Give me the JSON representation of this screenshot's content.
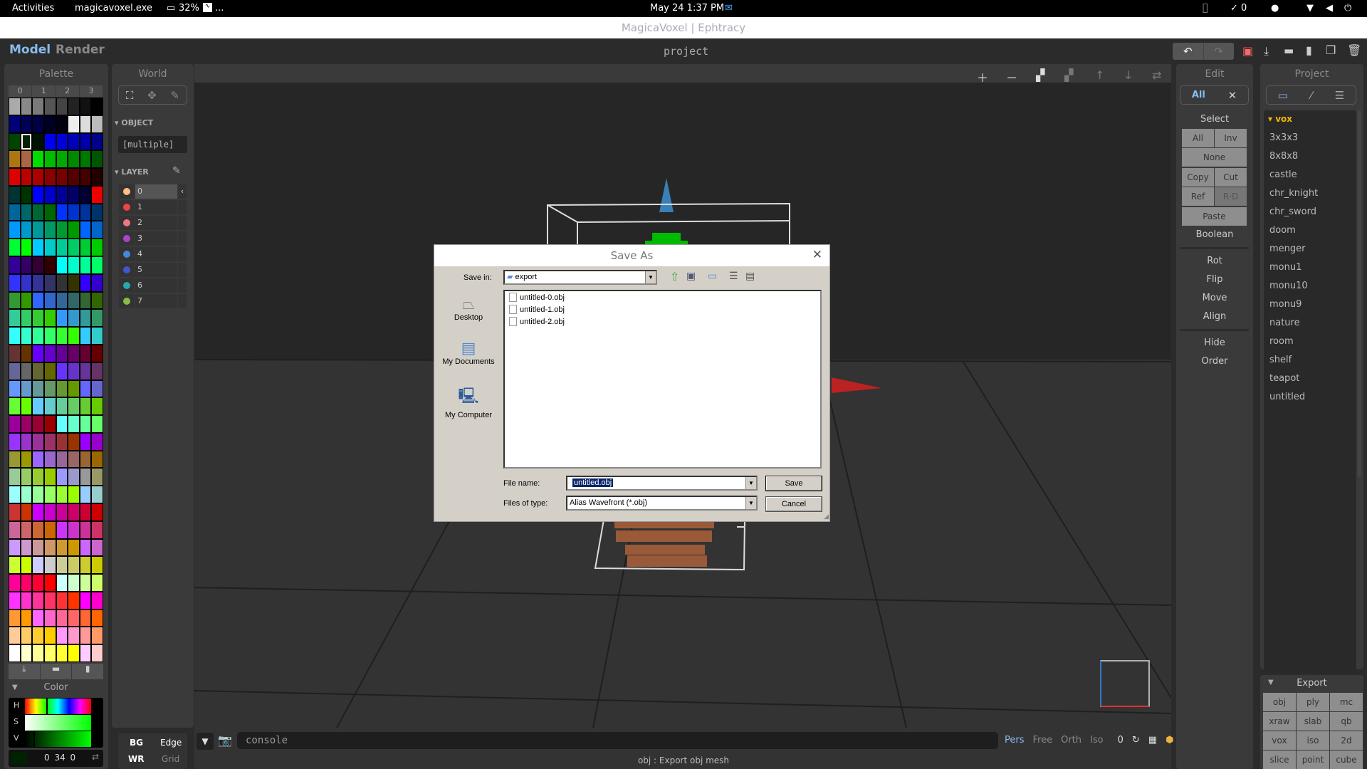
{
  "topbar": {
    "activities": "Activities",
    "app": "magicavoxel.exe",
    "cpu": "32%",
    "more": "...",
    "datetime": "May 24  1:37 PM",
    "check_count": "✓ 0"
  },
  "window_title": "MagicaVoxel | Ephtracy",
  "modes": {
    "model": "Model",
    "render": "Render"
  },
  "project_title": "project",
  "palette": {
    "title": "Palette",
    "tabs": [
      "0",
      "1",
      "2",
      "3"
    ],
    "selected_index": 17,
    "rows": [
      [
        "#aaaaaa",
        "#888888",
        "#7a7a7a",
        "#555555",
        "#444444",
        "#222222",
        "#111111",
        "#000000"
      ],
      [
        "#000077",
        "#000055",
        "#000044",
        "#000022",
        "#000011",
        "#eeeeee",
        "#dddddd",
        "#bbbbbb"
      ],
      [
        "#004400",
        "#002200",
        "#001100",
        "#0000ee",
        "#0000dd",
        "#0000bb",
        "#0000aa",
        "#000088"
      ],
      [
        "#aa7711",
        "#aa6644",
        "#00dd00",
        "#00bb00",
        "#00aa00",
        "#008800",
        "#007700",
        "#005500"
      ],
      [
        "#dd0000",
        "#bb0000",
        "#aa0000",
        "#880000",
        "#770000",
        "#550000",
        "#440000",
        "#220000"
      ],
      [
        "#003333",
        "#003300",
        "#0000ff",
        "#0000cc",
        "#000099",
        "#000066",
        "#000033",
        "#ee0000"
      ],
      [
        "#006699",
        "#006666",
        "#006633",
        "#006600",
        "#0033ff",
        "#0033cc",
        "#003399",
        "#003366"
      ],
      [
        "#0099ff",
        "#0099cc",
        "#009999",
        "#009966",
        "#009933",
        "#009900",
        "#0066ff",
        "#0066cc"
      ],
      [
        "#00ff33",
        "#00ff00",
        "#00ccff",
        "#00cccc",
        "#00cc99",
        "#00cc66",
        "#00cc33",
        "#00cc00"
      ],
      [
        "#330099",
        "#330066",
        "#330033",
        "#330000",
        "#00ffff",
        "#00ffcc",
        "#00ff99",
        "#00ff66"
      ],
      [
        "#3333ff",
        "#3333cc",
        "#333399",
        "#333366",
        "#333333",
        "#333300",
        "#3300ff",
        "#3300cc"
      ],
      [
        "#339933",
        "#339900",
        "#3366ff",
        "#3366cc",
        "#336699",
        "#336666",
        "#336633",
        "#336600"
      ],
      [
        "#33cc99",
        "#33cc66",
        "#33cc33",
        "#33cc00",
        "#3399ff",
        "#3399cc",
        "#339999",
        "#339966"
      ],
      [
        "#33ffff",
        "#33ffcc",
        "#33ff99",
        "#33ff66",
        "#33ff33",
        "#33ff00",
        "#33ccff",
        "#33cccc"
      ],
      [
        "#663333",
        "#663300",
        "#6600ff",
        "#6600cc",
        "#660099",
        "#660066",
        "#660033",
        "#660000"
      ],
      [
        "#666699",
        "#666666",
        "#666633",
        "#666600",
        "#6633ff",
        "#6633cc",
        "#663399",
        "#663366"
      ],
      [
        "#6699ff",
        "#6699cc",
        "#669999",
        "#669966",
        "#669933",
        "#669900",
        "#6666ff",
        "#6666cc"
      ],
      [
        "#66ff33",
        "#66ff00",
        "#66ccff",
        "#66cccc",
        "#66cc99",
        "#66cc66",
        "#66cc33",
        "#66cc00"
      ],
      [
        "#990099",
        "#990066",
        "#990033",
        "#990000",
        "#66ffff",
        "#66ffcc",
        "#66ff99",
        "#66ff66"
      ],
      [
        "#9933ff",
        "#9933cc",
        "#993399",
        "#993366",
        "#993333",
        "#993300",
        "#9900ff",
        "#9900cc"
      ],
      [
        "#999933",
        "#999900",
        "#9966ff",
        "#9966cc",
        "#996699",
        "#996666",
        "#996633",
        "#996600"
      ],
      [
        "#99cc99",
        "#99cc66",
        "#99cc33",
        "#99cc00",
        "#9999ff",
        "#9999cc",
        "#999999",
        "#999966"
      ],
      [
        "#99ffff",
        "#99ffcc",
        "#99ff99",
        "#99ff66",
        "#99ff33",
        "#99ff00",
        "#99ccff",
        "#99cccc"
      ],
      [
        "#cc3333",
        "#cc3300",
        "#cc00ff",
        "#cc00cc",
        "#cc0099",
        "#cc0066",
        "#cc0033",
        "#cc0000"
      ],
      [
        "#cc6699",
        "#cc6666",
        "#cc6633",
        "#cc6600",
        "#cc33ff",
        "#cc33cc",
        "#cc3399",
        "#cc3366"
      ],
      [
        "#cc99ff",
        "#cc99cc",
        "#cc9999",
        "#cc9966",
        "#cc9933",
        "#cc9900",
        "#cc66ff",
        "#cc66cc"
      ],
      [
        "#ccff33",
        "#ccff00",
        "#ccccff",
        "#cccccc",
        "#cccc99",
        "#cccc66",
        "#cccc33",
        "#cccc00"
      ],
      [
        "#ff0099",
        "#ff0066",
        "#ff0033",
        "#ff0000",
        "#ccffff",
        "#ccffcc",
        "#ccff99",
        "#ccff66"
      ],
      [
        "#ff33ff",
        "#ff33cc",
        "#ff3399",
        "#ff3366",
        "#ff3333",
        "#ff3300",
        "#ff00ff",
        "#ff00cc"
      ],
      [
        "#ff9933",
        "#ff9900",
        "#ff66ff",
        "#ff66cc",
        "#ff6699",
        "#ff6666",
        "#ff6633",
        "#ff6600"
      ],
      [
        "#ffcc99",
        "#ffcc66",
        "#ffcc33",
        "#ffcc00",
        "#ff99ff",
        "#ff99cc",
        "#ff9999",
        "#ff9966"
      ],
      [
        "#ffffff",
        "#ffffcc",
        "#ffff99",
        "#ffff66",
        "#ffff33",
        "#ffff00",
        "#ffccff",
        "#ffcccc"
      ]
    ]
  },
  "color": {
    "title": "Color",
    "h": "H",
    "s": "S",
    "v": "V",
    "value": "0 34 0",
    "swatch": "#002200"
  },
  "world": {
    "title": "World",
    "object_label": "OBJECT",
    "object_value": "[multiple]",
    "layer_label": "LAYER",
    "layers": [
      {
        "name": "0",
        "color": "#ffc080"
      },
      {
        "name": "1",
        "color": "#ee4444"
      },
      {
        "name": "2",
        "color": "#ee7788"
      },
      {
        "name": "3",
        "color": "#aa44cc"
      },
      {
        "name": "4",
        "color": "#4488dd"
      },
      {
        "name": "5",
        "color": "#4455cc"
      },
      {
        "name": "6",
        "color": "#22aaaa"
      },
      {
        "name": "7",
        "color": "#88bb44"
      }
    ],
    "bg": "BG",
    "edge": "Edge",
    "wr": "WR",
    "grid": "Grid"
  },
  "edit": {
    "title": "Edit",
    "all_tab": "All",
    "select": "Select",
    "all": "All",
    "inv": "Inv",
    "none": "None",
    "copy": "Copy",
    "cut": "Cut",
    "ref": "Ref",
    "rd": "R-D",
    "paste": "Paste",
    "boolean": "Boolean",
    "rot": "Rot",
    "flip": "Flip",
    "move": "Move",
    "align": "Align",
    "hide": "Hide",
    "order": "Order"
  },
  "project": {
    "title": "Project",
    "folder": "vox",
    "items": [
      "3x3x3",
      "8x8x8",
      "castle",
      "chr_knight",
      "chr_sword",
      "doom",
      "menger",
      "monu1",
      "monu10",
      "monu9",
      "nature",
      "room",
      "shelf",
      "teapot",
      "untitled"
    ]
  },
  "export": {
    "title": "Export",
    "buttons": [
      "obj",
      "ply",
      "mc",
      "xraw",
      "slab",
      "qb",
      "vox",
      "iso",
      "2d",
      "slice",
      "point",
      "cube"
    ]
  },
  "console": {
    "placeholder": "console",
    "views": [
      "Pers",
      "Free",
      "Orth",
      "Iso"
    ],
    "active_view": "Pers",
    "counter": "0",
    "status": "obj : Export obj mesh"
  },
  "accent": "#88bbee",
  "dialog": {
    "title": "Save As",
    "save_in_label": "Save in:",
    "save_in_value": "export",
    "places": [
      "Desktop",
      "My Documents",
      "My Computer"
    ],
    "files": [
      "untitled-0.obj",
      "untitled-1.obj",
      "untitled-2.obj"
    ],
    "file_name_label": "File name:",
    "file_name_value": "untitled.obj",
    "file_type_label": "Files of type:",
    "file_type_value": "Alias Wavefront (*.obj)",
    "save": "Save",
    "cancel": "Cancel"
  }
}
